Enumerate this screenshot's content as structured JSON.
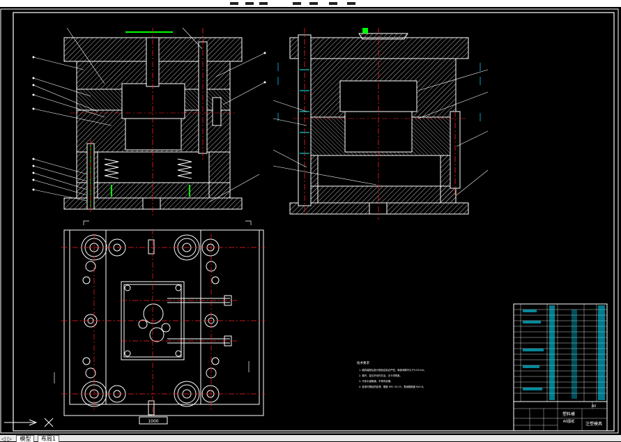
{
  "tabs": {
    "nav": "◁ ▷",
    "model": "模型",
    "layout1": "布局1"
  },
  "title_block": {
    "school": "塑料模",
    "part": "A0图纸",
    "drawing": "注塑模具",
    "sheet": "A0"
  },
  "notes": {
    "heading": "技术要求",
    "lines": [
      "1. 模具装配后各分型面应贴合严密，局部间隙不大于0.02mm。",
      "2. 推杆、复位杆动作灵活，无卡滞现象。",
      "3. 冷却水道畅通，不得有渗漏。",
      "4. 各零件需经热处理，硬度 HRC 50-55，表面粗糙度 Ra0.8。"
    ]
  },
  "scale_mark": "1000",
  "colors": {
    "bg": "#000000",
    "line": "#ffffff",
    "hatch": "#c8c8c8",
    "center": "#ff2020",
    "dim": "#00c8ff",
    "leader": "#ffffff",
    "green": "#00ff00",
    "cyan": "#00ffff"
  }
}
